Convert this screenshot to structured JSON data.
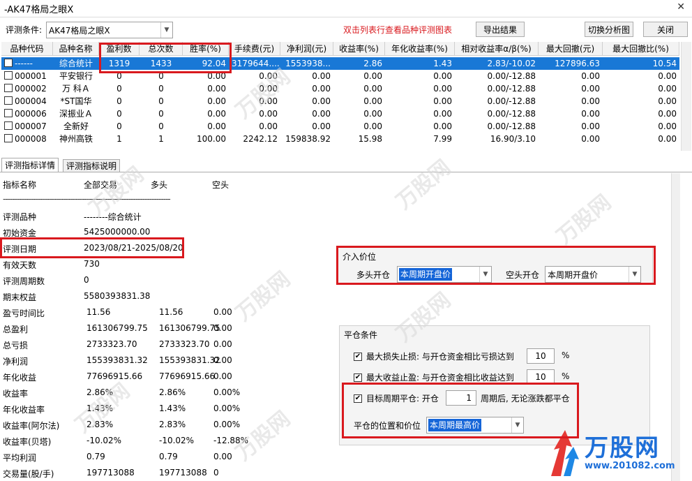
{
  "window": {
    "title": "-AK47格局之眼X",
    "close_glyph": "✕"
  },
  "toolbar": {
    "condition_label": "评测条件:",
    "condition_value": "AK47格局之眼X",
    "hint": "双击列表行查看品种评测图表",
    "export_label": "导出结果",
    "switch_label": "切换分析图",
    "close_label": "关闭"
  },
  "table": {
    "headers": [
      "品种代码",
      "品种名称",
      "盈利数",
      "总次数",
      "胜率(%)",
      "手续费(元)",
      "净利润(元)",
      "收益率(%)",
      "年化收益率(%)",
      "相对收益率α/β(%)",
      "最大回撤(元)",
      "最大回撤比(%)"
    ],
    "rows": [
      {
        "code": "------",
        "name": "综合统计",
        "wins": "1319",
        "total": "1433",
        "rate": "92.04",
        "fee": "3179644....",
        "profit": "1553938...",
        "ret": "2.86",
        "annual": "1.43",
        "alpha": "2.83/-10.02",
        "dd": "127896.63",
        "ddr": "10.54"
      },
      {
        "code": "000001",
        "name": "平安银行",
        "wins": "0",
        "total": "0",
        "rate": "0.00",
        "fee": "0.00",
        "profit": "0.00",
        "ret": "0.00",
        "annual": "0.00",
        "alpha": "0.00/-12.88",
        "dd": "0.00",
        "ddr": "0.00"
      },
      {
        "code": "000002",
        "name": "万 科Ａ",
        "wins": "0",
        "total": "0",
        "rate": "0.00",
        "fee": "0.00",
        "profit": "0.00",
        "ret": "0.00",
        "annual": "0.00",
        "alpha": "0.00/-12.88",
        "dd": "0.00",
        "ddr": "0.00"
      },
      {
        "code": "000004",
        "name": "*ST国华",
        "wins": "0",
        "total": "0",
        "rate": "0.00",
        "fee": "0.00",
        "profit": "0.00",
        "ret": "0.00",
        "annual": "0.00",
        "alpha": "0.00/-12.88",
        "dd": "0.00",
        "ddr": "0.00"
      },
      {
        "code": "000006",
        "name": "深振业Ａ",
        "wins": "0",
        "total": "0",
        "rate": "0.00",
        "fee": "0.00",
        "profit": "0.00",
        "ret": "0.00",
        "annual": "0.00",
        "alpha": "0.00/-12.88",
        "dd": "0.00",
        "ddr": "0.00"
      },
      {
        "code": "000007",
        "name": "全新好",
        "wins": "0",
        "total": "0",
        "rate": "0.00",
        "fee": "0.00",
        "profit": "0.00",
        "ret": "0.00",
        "annual": "0.00",
        "alpha": "0.00/-12.88",
        "dd": "0.00",
        "ddr": "0.00"
      },
      {
        "code": "000008",
        "name": "神州高铁",
        "wins": "1",
        "total": "1",
        "rate": "100.00",
        "fee": "2242.12",
        "profit": "159838.92",
        "ret": "15.98",
        "annual": "7.99",
        "alpha": "16.90/3.10",
        "dd": "0.00",
        "ddr": "0.00"
      }
    ]
  },
  "tabs": [
    "评测指标详情",
    "评测指标说明"
  ],
  "detail": {
    "headers": [
      "指标名称",
      "全部交易",
      "多头",
      "空头"
    ],
    "separator": "------------------------------------------------------------------------",
    "rows": [
      {
        "label": "评测品种",
        "v1": "--------综合统计",
        "v2": "",
        "v3": ""
      },
      {
        "label": "初始资金",
        "v1": "5425000000.00",
        "v2": "",
        "v3": ""
      },
      {
        "label": "评测日期",
        "v1": "2023/08/21-2025/08/20",
        "v2": "",
        "v3": ""
      },
      {
        "label": "有效天数",
        "v1": "730",
        "v2": "",
        "v3": ""
      },
      {
        "label": "评测周期数",
        "v1": "0",
        "v2": "",
        "v3": ""
      },
      {
        "label": "期末权益",
        "v1": "5580393831.38",
        "v2": "",
        "v3": ""
      },
      {
        "label": "盈亏时间比",
        "v1": "11.56",
        "v2": "11.56",
        "v3": "0.00"
      },
      {
        "label": "总盈利",
        "v1": "161306799.75",
        "v2": "161306799.75",
        "v3": "0.00"
      },
      {
        "label": "总亏损",
        "v1": "2733323.70",
        "v2": "2733323.70",
        "v3": "0.00"
      },
      {
        "label": "净利润",
        "v1": "155393831.32",
        "v2": "155393831.32",
        "v3": "0.00"
      },
      {
        "label": "年化收益",
        "v1": "77696915.66",
        "v2": "77696915.66",
        "v3": "0.00"
      },
      {
        "label": "收益率",
        "v1": "2.86%",
        "v2": "2.86%",
        "v3": "0.00%"
      },
      {
        "label": "年化收益率",
        "v1": "1.43%",
        "v2": "1.43%",
        "v3": "0.00%"
      },
      {
        "label": "收益率(阿尔法)",
        "v1": "2.83%",
        "v2": "2.83%",
        "v3": "0.00%"
      },
      {
        "label": "收益率(贝塔)",
        "v1": "-10.02%",
        "v2": "-10.02%",
        "v3": "-12.88%"
      },
      {
        "label": "平均利润",
        "v1": "0.79",
        "v2": "0.79",
        "v3": "0.00"
      },
      {
        "label": "交易量(股/手)",
        "v1": "197713088",
        "v2": "197713088",
        "v3": "0"
      }
    ]
  },
  "entry": {
    "title": "介入价位",
    "long_label": "多头开仓",
    "long_value": "本周期开盘价",
    "short_label": "空头开仓",
    "short_value": "本周期开盘价"
  },
  "exit": {
    "title": "平仓条件",
    "stop_loss_label": "最大损失止损: 与开仓资金相比亏损达到",
    "stop_loss_value": "10",
    "take_profit_label": "最大收益止盈: 与开仓资金相比收益达到",
    "take_profit_value": "10",
    "percent": "%",
    "period_label_a": "目标周期平仓: 开仓",
    "period_value": "1",
    "period_label_b": "周期后, 无论涨跌都平仓",
    "position_label": "平仓的位置和价位",
    "position_value": "本周期最高价",
    "checkmark": "✔"
  },
  "watermark": {
    "text": "万股网",
    "url": "www.201082.com"
  },
  "colors": {
    "highlight": "#d9191e",
    "selection": "#1978d6",
    "hint": "#d9191e"
  }
}
